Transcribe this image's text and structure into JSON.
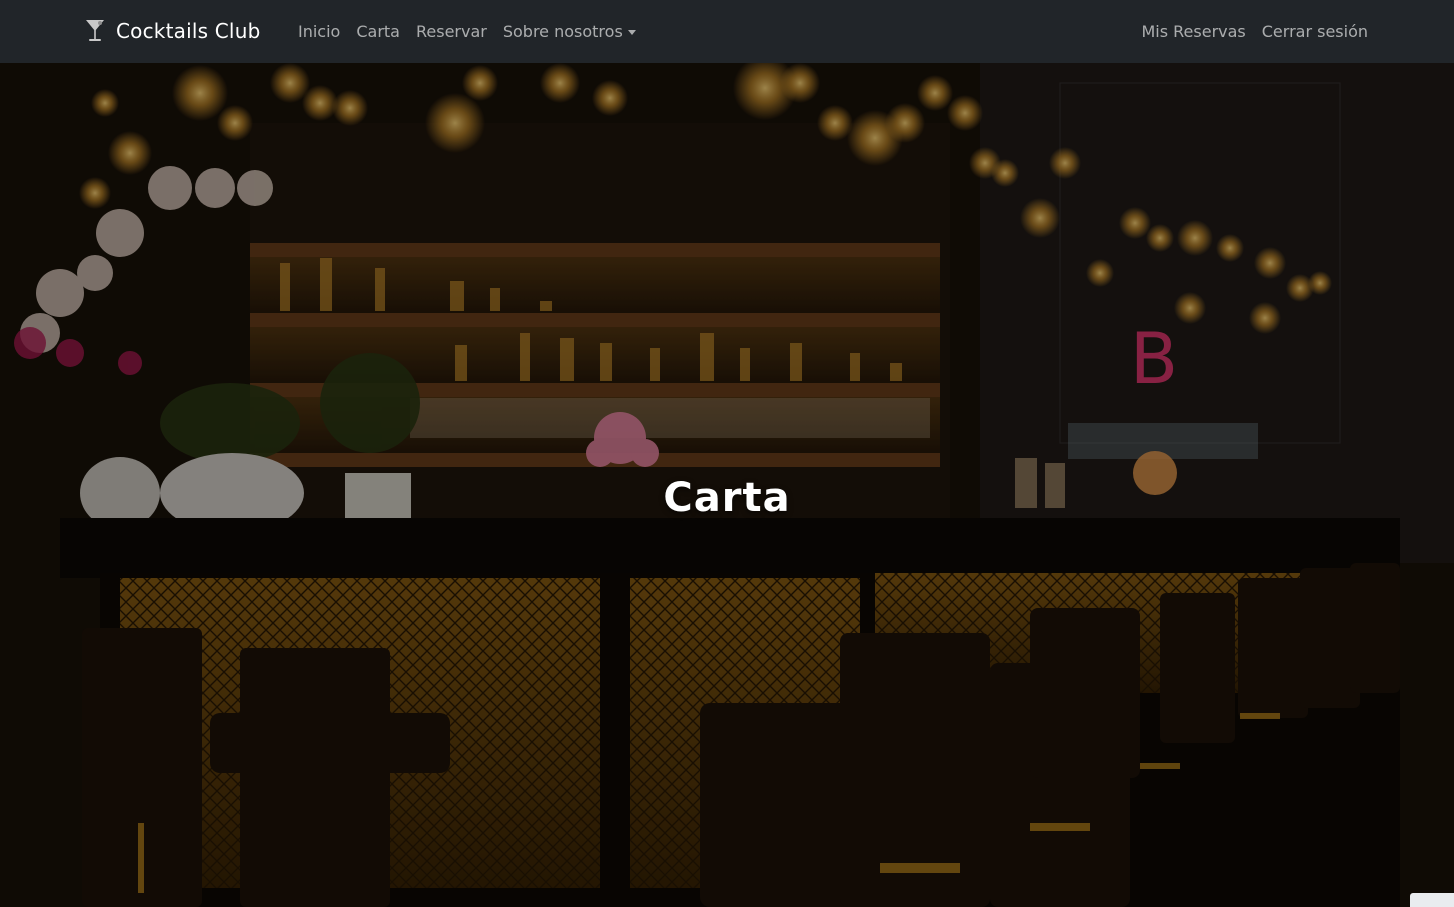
{
  "navbar": {
    "brand": "Cocktails Club",
    "brand_icon": "cocktail-glass-icon",
    "links": [
      "Inicio",
      "Carta",
      "Reservar"
    ],
    "dropdown_label": "Sobre nosotros",
    "right_links": [
      "Mis Reservas",
      "Cerrar sesión"
    ]
  },
  "hero": {
    "title": "Carta"
  },
  "colors": {
    "navbar_bg": "#212529",
    "nav_text": "#9a9da0",
    "hero_title": "#ffffff"
  }
}
